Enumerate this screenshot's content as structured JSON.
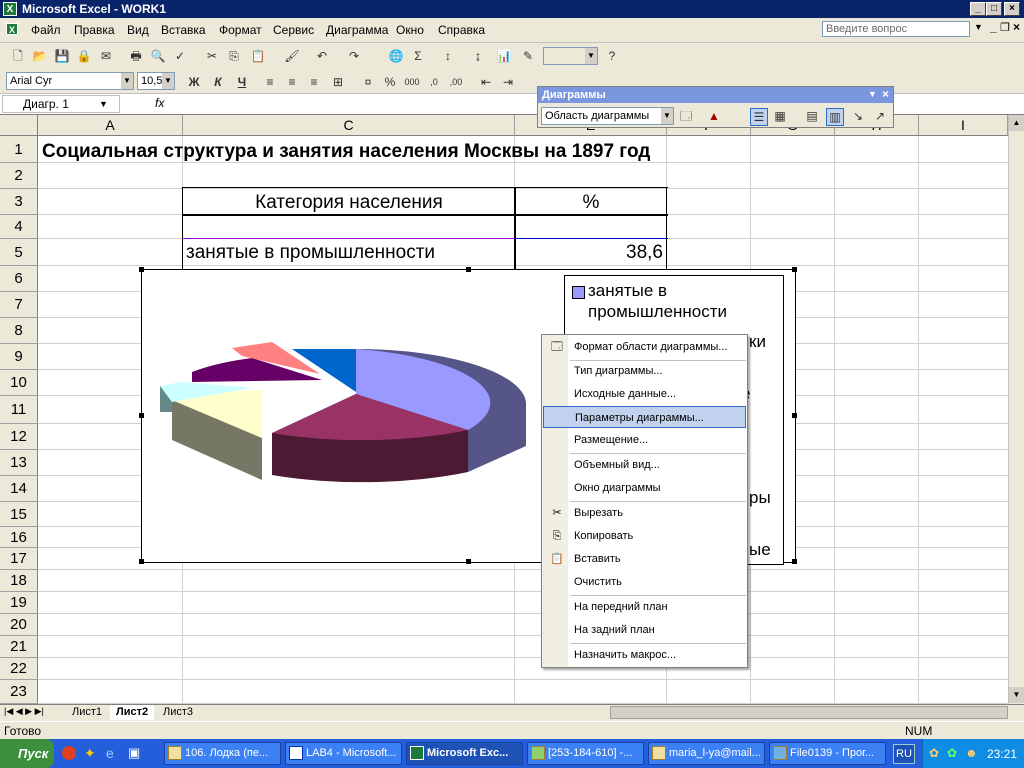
{
  "window": {
    "title": "Microsoft Excel - WORK1",
    "app_icon": "excel-icon"
  },
  "menu": {
    "items": [
      "Файл",
      "Правка",
      "Вид",
      "Вставка",
      "Формат",
      "Сервис",
      "Диаграмма",
      "Окно",
      "Справка"
    ],
    "ask_placeholder": "Введите вопрос"
  },
  "formatting": {
    "font": "Arial Cyr",
    "size": "10,5",
    "bold": "Ж",
    "italic": "К",
    "underline": "Ч"
  },
  "formula_bar": {
    "name_box": "Диагр. 1",
    "fx": "fx"
  },
  "charts_toolbar": {
    "title": "Диаграммы",
    "element": "Область диаграммы"
  },
  "columns": [
    "A",
    "C",
    "E",
    "F",
    "G",
    "H",
    "I"
  ],
  "rows": [
    "1",
    "2",
    "3",
    "4",
    "5",
    "6",
    "7",
    "8",
    "9",
    "10",
    "11",
    "12",
    "13",
    "14",
    "15",
    "16",
    "17",
    "18",
    "19",
    "20",
    "21",
    "22",
    "23"
  ],
  "cells": {
    "title": "Социальная структура и занятия населения Москвы на 1897 год",
    "header_category": "Категория населения",
    "header_percent": "%",
    "row5_category": "занятые в промышленности",
    "row5_value": "38,6"
  },
  "chart_data": {
    "type": "pie",
    "categories": [
      "занятые в промышленности"
    ],
    "values": [
      38.6
    ],
    "legend_position": "right",
    "legend_entries": [
      "занятые в",
      "промышленности"
    ],
    "legend_partial": [
      "ки",
      "е",
      "ры",
      "ые"
    ],
    "colors": [
      "#9999ff",
      "#993366",
      "#ffffcc",
      "#ccffff",
      "#660066",
      "#ff8080",
      "#0066cc"
    ]
  },
  "context_menu": {
    "items": [
      {
        "label": "Формат области диаграммы...",
        "icon": "format-chart-icon"
      },
      {
        "label": "Тип диаграммы..."
      },
      {
        "label": "Исходные данные..."
      },
      {
        "label": "Параметры диаграммы...",
        "selected": true
      },
      {
        "label": "Размещение..."
      },
      {
        "label": "Объемный вид..."
      },
      {
        "label": "Окно диаграммы"
      },
      {
        "label": "Вырезать",
        "icon": "scissors-icon"
      },
      {
        "label": "Копировать",
        "icon": "copy-icon"
      },
      {
        "label": "Вставить",
        "icon": "paste-icon"
      },
      {
        "label": "Очистить"
      },
      {
        "label": "На передний план"
      },
      {
        "label": "На задний план"
      },
      {
        "label": "Назначить макрос..."
      }
    ]
  },
  "sheets": {
    "tabs": [
      "Лист1",
      "Лист2",
      "Лист3"
    ],
    "active": "Лист2"
  },
  "status": {
    "left": "Готово",
    "num": "NUM"
  },
  "taskbar": {
    "start": "Пуск",
    "tasks": [
      "106. Лодка (пе...",
      "LAB4 - Microsoft...",
      "Microsoft Exc...",
      "[253-184-610] -...",
      "maria_l-ya@mail...",
      "File0139 - Прог..."
    ],
    "lang": "RU",
    "clock": "23:21"
  }
}
